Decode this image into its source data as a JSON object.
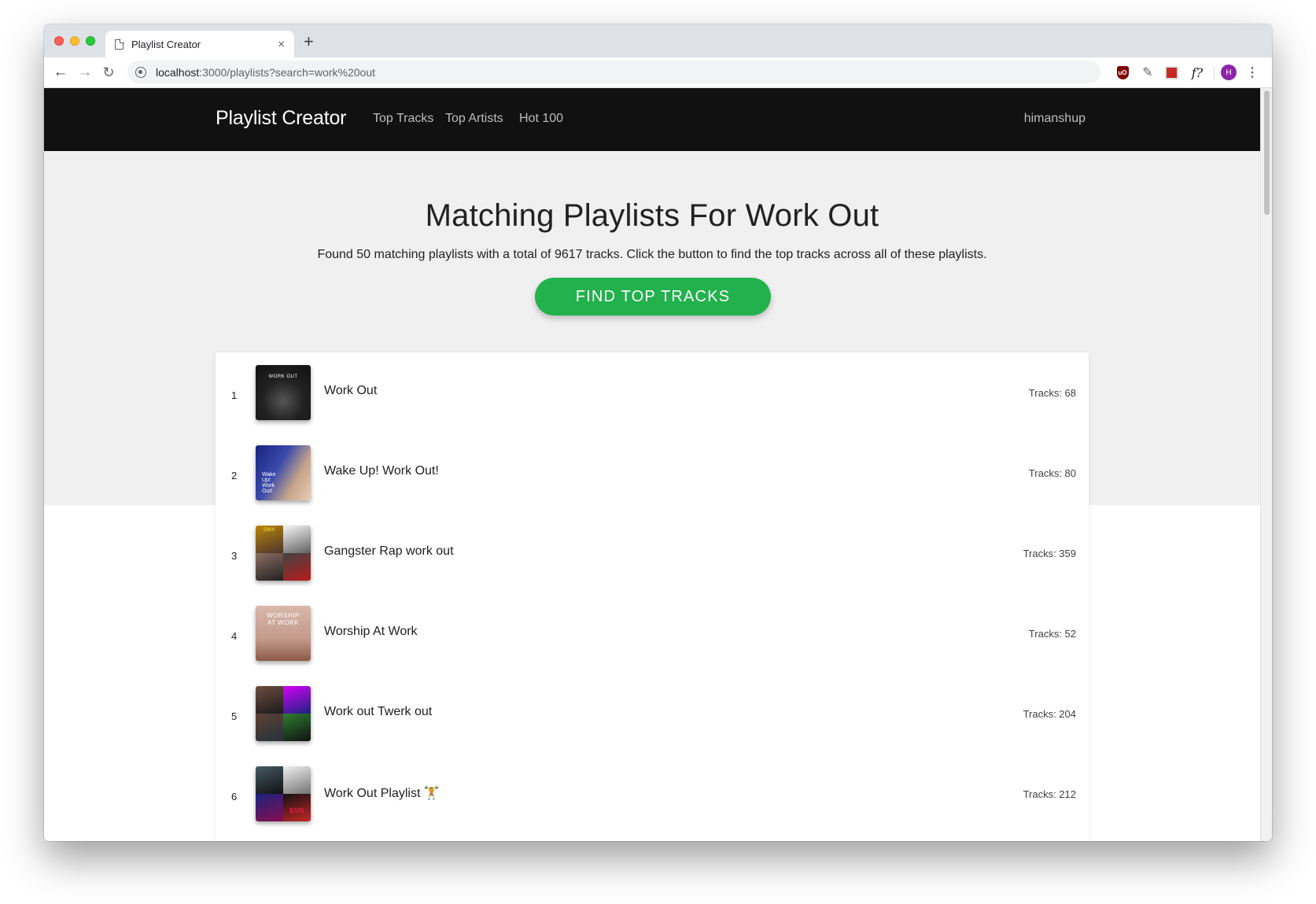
{
  "browser": {
    "tab_title": "Playlist Creator",
    "tab_close": "×",
    "new_tab": "+",
    "url_host": "localhost",
    "url_path": ":3000/playlists?search=work%20out",
    "avatar_letter": "H",
    "extension_font_label": "f?"
  },
  "nav": {
    "brand": "Playlist Creator",
    "links": [
      "Top Tracks",
      "Top Artists",
      "Hot 100"
    ],
    "user": "himanshup"
  },
  "hero": {
    "title": "Matching Playlists For Work Out",
    "subtitle": "Found 50 matching playlists with a total of 9617 tracks. Click the button to find the top tracks across all of these playlists.",
    "button_label": "FIND TOP TRACKS"
  },
  "playlists": [
    {
      "rank": "1",
      "name": "Work Out",
      "tracks": "Tracks: 68",
      "cover_text": "WORK OUT"
    },
    {
      "rank": "2",
      "name": "Wake Up! Work Out!",
      "tracks": "Tracks: 80",
      "cover_text": "Wake Up! Work Out!"
    },
    {
      "rank": "3",
      "name": "Gangster Rap work out",
      "tracks": "Tracks: 359",
      "cover_text": "DMX"
    },
    {
      "rank": "4",
      "name": "Worship At Work",
      "tracks": "Tracks: 52",
      "cover_text": "WORSHIP AT WORK"
    },
    {
      "rank": "5",
      "name": "Work out Twerk out",
      "tracks": "Tracks: 204",
      "cover_text": ""
    },
    {
      "rank": "6",
      "name": "Work Out Playlist 🏋",
      "tracks": "Tracks: 212",
      "cover_text": "EVO"
    }
  ],
  "colors": {
    "accent_green": "#22b14c",
    "navbar": "#111111",
    "hero_bg": "#f0f0f0"
  },
  "icons": [
    "back-arrow-icon",
    "forward-arrow-icon",
    "reload-icon",
    "site-info-icon",
    "ublock-icon",
    "eyedropper-icon",
    "image-extension-icon",
    "whatfont-icon",
    "kebab-menu-icon",
    "document-icon"
  ]
}
